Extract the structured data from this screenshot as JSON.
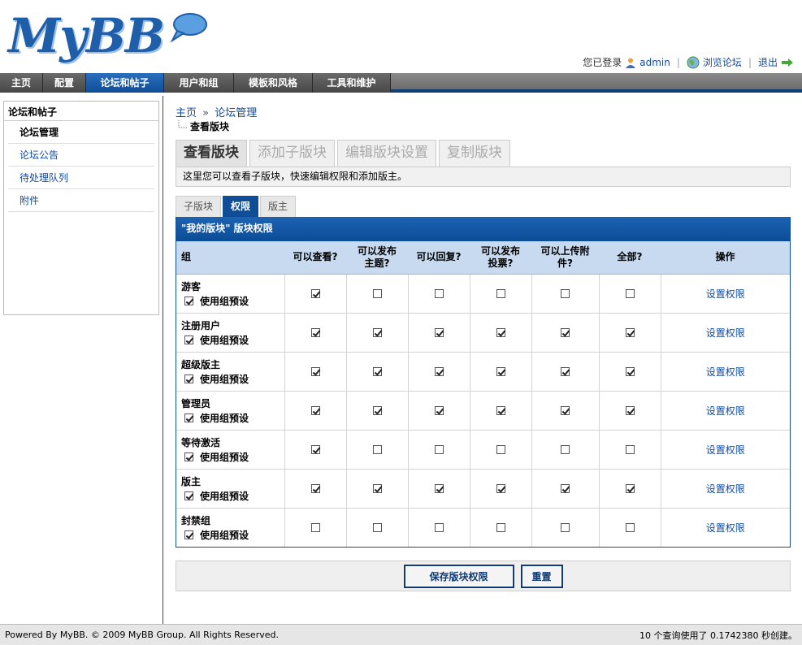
{
  "header": {
    "logo_text": "MyBB",
    "user": {
      "logged_in_label": "您已登录",
      "username": "admin",
      "sep1": "|",
      "view_forum": "浏览论坛",
      "sep2": "|",
      "logout": "退出"
    }
  },
  "nav": {
    "tabs": [
      {
        "label": "主页",
        "active": false
      },
      {
        "label": "配置",
        "active": false
      },
      {
        "label": "论坛和帖子",
        "active": true
      },
      {
        "label": "用户和组",
        "active": false
      },
      {
        "label": "模板和风格",
        "active": false
      },
      {
        "label": "工具和维护",
        "active": false
      }
    ]
  },
  "sidebar": {
    "title": "论坛和帖子",
    "items": [
      {
        "label": "论坛管理",
        "current": true
      },
      {
        "label": "论坛公告",
        "current": false
      },
      {
        "label": "待处理队列",
        "current": false
      },
      {
        "label": "附件",
        "current": false
      }
    ]
  },
  "breadcrumb": {
    "home": "主页",
    "sep": "»",
    "forum_manage": "论坛管理",
    "current": "查看版块"
  },
  "subtabs": [
    {
      "label": "查看版块",
      "active": true
    },
    {
      "label": "添加子版块",
      "active": false
    },
    {
      "label": "编辑版块设置",
      "active": false
    },
    {
      "label": "复制版块",
      "active": false
    }
  ],
  "description": "这里您可以查看子版块，快速编辑权限和添加版主。",
  "panel_tabs": [
    {
      "label": "子版块",
      "active": false
    },
    {
      "label": "权限",
      "active": true
    },
    {
      "label": "版主",
      "active": false
    }
  ],
  "permissions": {
    "title": "\"我的版块\" 版块权限",
    "columns": {
      "group": "组",
      "view": "可以查看?",
      "post_threads_1": "可以发布",
      "post_threads_2": "主题?",
      "reply": "可以回复?",
      "post_polls_1": "可以发布",
      "post_polls_2": "投票?",
      "upload_1": "可以上传附",
      "upload_2": "件?",
      "all": "全部?",
      "actions": "操作"
    },
    "use_default_label": "使用组预设",
    "action_label": "设置权限",
    "rows": [
      {
        "group": "游客",
        "use_default": true,
        "perms": [
          true,
          false,
          false,
          false,
          false,
          false
        ]
      },
      {
        "group": "注册用户",
        "use_default": true,
        "perms": [
          true,
          true,
          true,
          true,
          true,
          true
        ]
      },
      {
        "group": "超级版主",
        "use_default": true,
        "perms": [
          true,
          true,
          true,
          true,
          true,
          true
        ]
      },
      {
        "group": "管理员",
        "use_default": true,
        "perms": [
          true,
          true,
          true,
          true,
          true,
          true
        ]
      },
      {
        "group": "等待激活",
        "use_default": true,
        "perms": [
          true,
          false,
          false,
          false,
          false,
          false
        ]
      },
      {
        "group": "版主",
        "use_default": true,
        "perms": [
          true,
          true,
          true,
          true,
          true,
          true
        ]
      },
      {
        "group": "封禁组",
        "use_default": true,
        "perms": [
          false,
          false,
          false,
          false,
          false,
          false
        ]
      }
    ]
  },
  "buttons": {
    "save": "保存版块权限",
    "reset": "重置"
  },
  "footer": {
    "left": "Powered By MyBB. © 2009 MyBB Group. All Rights Reserved.",
    "right": "10 个查询使用了 0.1742380 秒创建。"
  },
  "colors": {
    "accent": "#0f4d96",
    "nav_bg": "#4b4b4b",
    "link": "#0f4ba3",
    "header_row": "#c7daf0"
  }
}
